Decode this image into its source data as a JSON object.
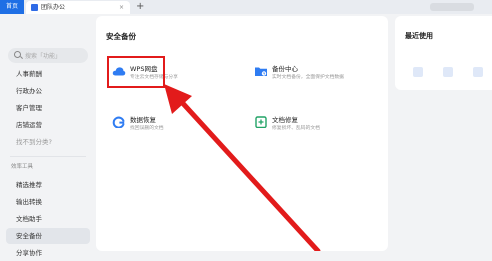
{
  "tabs": {
    "home": "首页",
    "office": "团队办公",
    "close": "×",
    "add": "+"
  },
  "sidebar": {
    "search_placeholder": "搜索「功能」",
    "items": [
      {
        "label": "人事薪酬"
      },
      {
        "label": "行政办公"
      },
      {
        "label": "客户管理"
      },
      {
        "label": "店铺运营"
      },
      {
        "label": "找不到分类?"
      }
    ],
    "section_label": "效率工具",
    "tools": [
      {
        "label": "精选推荐"
      },
      {
        "label": "输出转换"
      },
      {
        "label": "文档助手"
      },
      {
        "label": "安全备份"
      },
      {
        "label": "分享协作"
      }
    ]
  },
  "main": {
    "title": "安全备份",
    "cards": [
      {
        "name": "WPS网盘",
        "desc": "专注云文档存储与分享"
      },
      {
        "name": "备份中心",
        "desc": "实时文档备份，全面保护文档数据"
      },
      {
        "name": "数据恢复",
        "desc": "找回误删的文档"
      },
      {
        "name": "文档修复",
        "desc": "修复损坏、乱码的文档"
      }
    ]
  },
  "right_panel": {
    "title": "最近使用"
  },
  "colors": {
    "accent": "#1f6fe5",
    "annotation_red": "#e21b1b"
  }
}
